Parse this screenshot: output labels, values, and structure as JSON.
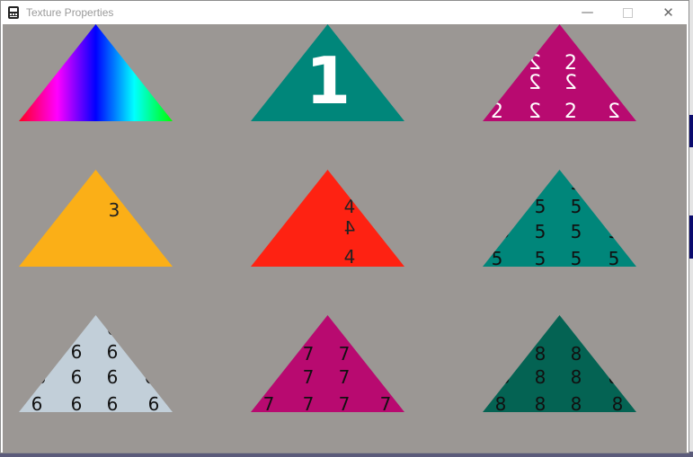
{
  "window": {
    "title": "Texture Properties",
    "icon": "app-window-icon",
    "controls": {
      "minimize_icon": "minimize-icon",
      "maximize_icon": "maximize-icon",
      "close_icon": "close-icon",
      "minimize_glyph": "—",
      "close_glyph": "✕"
    }
  },
  "canvas": {
    "background": "#9b9794",
    "triangles": [
      {
        "name": "triangle-1-gradient",
        "fill": "gradient-rainbow",
        "labels": []
      },
      {
        "name": "triangle-2-label-1",
        "fill": "#00867a",
        "label_color": "#ffffff",
        "labels": [
          "1"
        ]
      },
      {
        "name": "triangle-3-label-2",
        "fill": "#b80a70",
        "label_color": "#ffffff",
        "labels": [
          "2",
          "2",
          "2",
          "2",
          "2",
          "2",
          "2",
          "2"
        ]
      },
      {
        "name": "triangle-4-label-3",
        "fill": "#fbaf17",
        "label_color": "#222222",
        "labels": [
          "3"
        ]
      },
      {
        "name": "triangle-5-label-4",
        "fill": "#fe2212",
        "label_color": "#222222",
        "labels": [
          "4",
          "4",
          "4"
        ]
      },
      {
        "name": "triangle-6-label-5",
        "fill": "#00867a",
        "label_color": "#111111",
        "labels": [
          "5",
          "5",
          "5",
          "5",
          "5",
          "5",
          "5",
          "5",
          "5",
          "5",
          "5",
          "5"
        ]
      },
      {
        "name": "triangle-7-label-6",
        "fill": "#c2cfd9",
        "label_color": "#111111",
        "labels": [
          "6",
          "6",
          "6",
          "6",
          "6",
          "6",
          "6",
          "6",
          "6",
          "6",
          "6",
          "6"
        ]
      },
      {
        "name": "triangle-8-label-7",
        "fill": "#b80a70",
        "label_color": "#111111",
        "labels": [
          "7",
          "7",
          "7",
          "7",
          "7",
          "7",
          "7",
          "7"
        ]
      },
      {
        "name": "triangle-9-label-8",
        "fill": "#046353",
        "label_color": "#111111",
        "labels": [
          "8",
          "8",
          "8",
          "8",
          "8",
          "8",
          "8",
          "8",
          "8",
          "8"
        ]
      }
    ]
  }
}
